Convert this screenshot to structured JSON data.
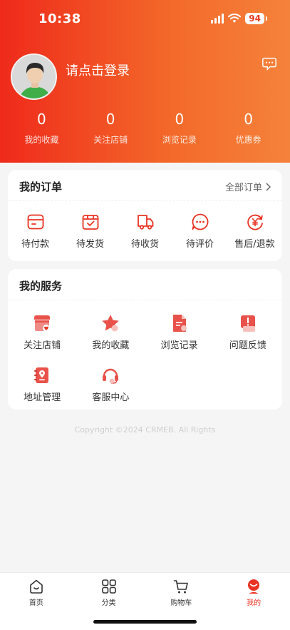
{
  "status_bar": {
    "time": "10:38",
    "battery": "94"
  },
  "profile": {
    "login_prompt": "请点击登录"
  },
  "stats": [
    {
      "value": "0",
      "label": "我的收藏"
    },
    {
      "value": "0",
      "label": "关注店铺"
    },
    {
      "value": "0",
      "label": "浏览记录"
    },
    {
      "value": "0",
      "label": "优惠券"
    }
  ],
  "orders": {
    "title": "我的订单",
    "all_label": "全部订单",
    "items": [
      {
        "label": "待付款",
        "icon": "wallet-icon"
      },
      {
        "label": "待发货",
        "icon": "package-check-icon"
      },
      {
        "label": "待收货",
        "icon": "delivery-truck-icon"
      },
      {
        "label": "待评价",
        "icon": "comment-icon"
      },
      {
        "label": "售后/退款",
        "icon": "refund-icon"
      }
    ]
  },
  "services": {
    "title": "我的服务",
    "items": [
      {
        "label": "关注店铺",
        "icon": "store-heart-icon"
      },
      {
        "label": "我的收藏",
        "icon": "star-icon"
      },
      {
        "label": "浏览记录",
        "icon": "document-icon"
      },
      {
        "label": "问题反馈",
        "icon": "feedback-icon"
      },
      {
        "label": "地址管理",
        "icon": "address-book-icon"
      },
      {
        "label": "客服中心",
        "icon": "headset-icon"
      }
    ]
  },
  "footer": {
    "copyright": "Copyright ©2024 CRMEB. All Rights"
  },
  "tabbar": {
    "items": [
      {
        "label": "首页",
        "icon": "home-icon"
      },
      {
        "label": "分类",
        "icon": "category-grid-icon"
      },
      {
        "label": "购物车",
        "icon": "cart-icon"
      },
      {
        "label": "我的",
        "icon": "user-icon"
      }
    ],
    "active_index": 3
  },
  "colors": {
    "brand": "#e93323",
    "header_gradient_start": "#ef2a1b",
    "header_gradient_end": "#f5823a"
  }
}
